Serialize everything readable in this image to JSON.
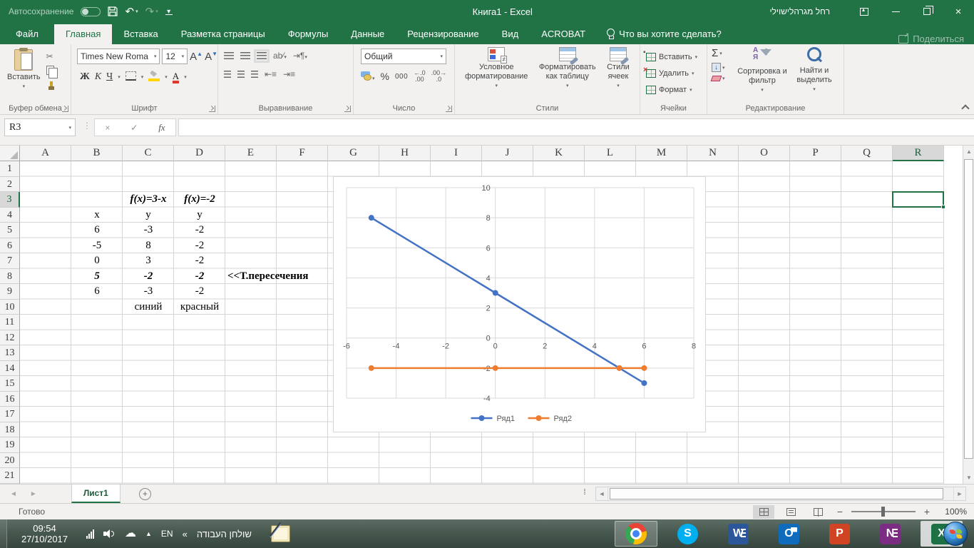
{
  "title_bar": {
    "autosave_label": "Автосохранение",
    "workbook_title": "Книга1  -  Excel",
    "user_name": "רחל מגרהלישוילי"
  },
  "tab_row": {
    "tabs": [
      {
        "label": "Файл",
        "type": "file"
      },
      {
        "label": "Главная",
        "type": "active"
      },
      {
        "label": "Вставка",
        "type": "normal"
      },
      {
        "label": "Разметка страницы",
        "type": "normal"
      },
      {
        "label": "Формулы",
        "type": "normal"
      },
      {
        "label": "Данные",
        "type": "normal"
      },
      {
        "label": "Рецензирование",
        "type": "normal"
      },
      {
        "label": "Вид",
        "type": "normal"
      },
      {
        "label": "ACROBAT",
        "type": "normal"
      }
    ],
    "tell_me": "Что вы хотите сделать?",
    "share_label": "Поделиться"
  },
  "ribbon": {
    "clipboard": {
      "paste": "Вставить",
      "label": "Буфер обмена"
    },
    "font": {
      "family": "Times New Roma",
      "size": "12",
      "bold": "Ж",
      "italic": "К",
      "underline": "Ч",
      "label": "Шрифт"
    },
    "alignment": {
      "label": "Выравнивание"
    },
    "number": {
      "format": "Общий",
      "percent": "%",
      "thousands": "000",
      "label": "Число"
    },
    "styles": {
      "conditional": "Условное форматирование",
      "format_table": "Форматировать как таблицу",
      "cell_styles": "Стили ячеек",
      "label": "Стили"
    },
    "cells": {
      "insert": "Вставить",
      "delete": "Удалить",
      "format": "Формат",
      "label": "Ячейки"
    },
    "editing": {
      "sort": "Сортировка и фильтр",
      "find": "Найти и выделить",
      "label": "Редактирование"
    }
  },
  "formula_bar": {
    "name_box": "R3",
    "formula": ""
  },
  "grid": {
    "columns": [
      "A",
      "B",
      "C",
      "D",
      "E",
      "F",
      "G",
      "H",
      "I",
      "J",
      "K",
      "L",
      "M",
      "N",
      "O",
      "P",
      "Q",
      "R"
    ],
    "rows": [
      "1",
      "2",
      "3",
      "4",
      "5",
      "6",
      "7",
      "8",
      "9",
      "10",
      "11",
      "12",
      "13",
      "14",
      "15",
      "16",
      "17",
      "18",
      "19",
      "20",
      "21"
    ],
    "selected_column": "R",
    "selected_row": "3",
    "cells": [
      {
        "col": "C",
        "row": 3,
        "text": "f(x)=3-x",
        "style": "bi"
      },
      {
        "col": "D",
        "row": 3,
        "text": "f(x)=-2",
        "style": "bi"
      },
      {
        "col": "B",
        "row": 4,
        "text": "x",
        "style": ""
      },
      {
        "col": "C",
        "row": 4,
        "text": "y",
        "style": ""
      },
      {
        "col": "D",
        "row": 4,
        "text": "y",
        "style": ""
      },
      {
        "col": "B",
        "row": 5,
        "text": "6",
        "style": ""
      },
      {
        "col": "C",
        "row": 5,
        "text": "-3",
        "style": ""
      },
      {
        "col": "D",
        "row": 5,
        "text": "-2",
        "style": ""
      },
      {
        "col": "B",
        "row": 6,
        "text": "-5",
        "style": ""
      },
      {
        "col": "C",
        "row": 6,
        "text": "8",
        "style": ""
      },
      {
        "col": "D",
        "row": 6,
        "text": "-2",
        "style": ""
      },
      {
        "col": "B",
        "row": 7,
        "text": "0",
        "style": ""
      },
      {
        "col": "C",
        "row": 7,
        "text": "3",
        "style": ""
      },
      {
        "col": "D",
        "row": 7,
        "text": "-2",
        "style": ""
      },
      {
        "col": "B",
        "row": 8,
        "text": "5",
        "style": "bi"
      },
      {
        "col": "C",
        "row": 8,
        "text": "-2",
        "style": "bi"
      },
      {
        "col": "D",
        "row": 8,
        "text": "-2",
        "style": "bi"
      },
      {
        "col": "E",
        "row": 8,
        "text": "<<Т.пересечения",
        "style": "b",
        "align": "left"
      },
      {
        "col": "B",
        "row": 9,
        "text": "6",
        "style": ""
      },
      {
        "col": "C",
        "row": 9,
        "text": "-3",
        "style": ""
      },
      {
        "col": "D",
        "row": 9,
        "text": "-2",
        "style": ""
      },
      {
        "col": "C",
        "row": 10,
        "text": "синий",
        "style": ""
      },
      {
        "col": "D",
        "row": 10,
        "text": "красный",
        "style": ""
      }
    ]
  },
  "chart_data": {
    "type": "scatter",
    "title": "",
    "xlabel": "",
    "ylabel": "",
    "xlim": [
      -6,
      8
    ],
    "ylim": [
      -4,
      10
    ],
    "x_ticks": [
      -6,
      -4,
      -2,
      0,
      2,
      4,
      6,
      8
    ],
    "y_ticks": [
      -4,
      -2,
      0,
      2,
      4,
      6,
      8,
      10
    ],
    "grid": true,
    "legend_position": "bottom",
    "series": [
      {
        "name": "Ряд1",
        "color": "#4472C4",
        "points": [
          [
            -5,
            8
          ],
          [
            0,
            3
          ],
          [
            5,
            -2
          ],
          [
            6,
            -3
          ]
        ]
      },
      {
        "name": "Ряд2",
        "color": "#ED7D31",
        "points": [
          [
            -5,
            -2
          ],
          [
            0,
            -2
          ],
          [
            5,
            -2
          ],
          [
            6,
            -2
          ]
        ]
      }
    ]
  },
  "sheet_bar": {
    "sheet_tab": "Лист1"
  },
  "status_bar": {
    "status": "Готово",
    "zoom": "100%"
  },
  "taskbar": {
    "time": "09:54",
    "date": "27/10/2017",
    "language": "EN",
    "chevron": "«",
    "desktop_toolbar": "שולחן העבודה",
    "apps": [
      {
        "name": "chrome",
        "glyph": "",
        "state": "open"
      },
      {
        "name": "skype",
        "glyph": "S",
        "state": ""
      },
      {
        "name": "word",
        "glyph": "W",
        "state": ""
      },
      {
        "name": "outlook",
        "glyph": "O",
        "state": ""
      },
      {
        "name": "powerpoint",
        "glyph": "P",
        "state": ""
      },
      {
        "name": "onenote",
        "glyph": "N",
        "state": ""
      },
      {
        "name": "excel",
        "glyph": "X",
        "state": "activewin"
      }
    ]
  }
}
